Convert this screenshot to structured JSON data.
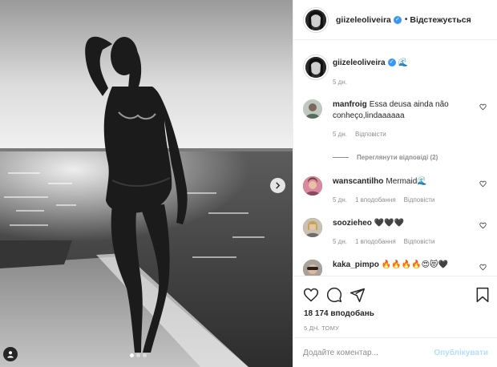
{
  "post": {
    "username": "giizeleoliveira",
    "follow_state": "Відстежується",
    "separator": "•",
    "caption_emoji": "🌊",
    "caption_time": "5 дн."
  },
  "comments": [
    {
      "user": "manfroig",
      "text": "Essa deusa ainda não conheço,lindaaaaaa",
      "time": "5 дн.",
      "likes": "",
      "reply": "Відповісти"
    },
    {
      "user": "wanscantilho",
      "text": "Mermaid🌊",
      "time": "5 дн.",
      "likes": "1 вподобання",
      "reply": "Відповісти"
    },
    {
      "user": "soozieheo",
      "text": "🖤🖤🖤",
      "time": "5 дн.",
      "likes": "1 вподобання",
      "reply": "Відповісти"
    },
    {
      "user": "kaka_pimpo",
      "text": "🔥🔥🔥🔥😍😻🖤",
      "time": "",
      "likes": "",
      "reply": ""
    }
  ],
  "view_replies": "Переглянути відповіді (2)",
  "actions": {
    "icons": [
      "heart-icon",
      "comment-icon",
      "share-icon",
      "bookmark-icon"
    ]
  },
  "likes_count": "18 174 вподобань",
  "time_ago": "5 ДН. ТОМУ",
  "add_comment": {
    "placeholder": "Додайте коментар...",
    "publish_label": "Опублікувати"
  },
  "carousel": {
    "total": 3,
    "active": 1
  },
  "colors": {
    "verified": "#3897f0",
    "publish_disabled": "#b2dffc",
    "muted": "#8e8e8e"
  }
}
